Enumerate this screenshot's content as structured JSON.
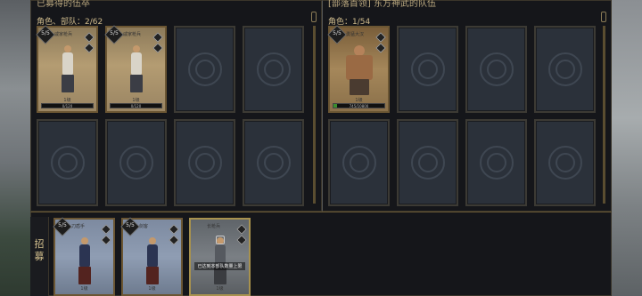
{
  "left_panel": {
    "title": "已募得的伍卒",
    "count_label": "角色、部队：2/62",
    "cards": [
      {
        "level": "5/5",
        "name": "戚家枪兵",
        "tier": "1级",
        "exp": "0/120",
        "exp_fraction": 0.0
      },
      {
        "level": "5/5",
        "name": "戚家枪兵",
        "tier": "1级",
        "exp": "0/120",
        "exp_fraction": 0.0
      }
    ]
  },
  "right_panel": {
    "title": "[部落首领] 东方神武的队伍",
    "count_label": "角色：1/54",
    "cards": [
      {
        "level": "5/5",
        "name": "勇猛大汉",
        "tier": "1级",
        "exp": "745/10800",
        "exp_fraction": 0.069
      }
    ]
  },
  "recruit": {
    "tab_label": "招募",
    "cards": [
      {
        "level": "5/5",
        "name": "刀盾手",
        "tier": "1级"
      },
      {
        "level": "5/5",
        "name": "剑客",
        "tier": "1级"
      },
      {
        "name": "长枪兵",
        "tier": "1级",
        "lock_note": "已达到本部队数量上限"
      }
    ]
  },
  "icons": {
    "empty_slot": "hexagram-emblem-icon",
    "lock": "lock-icon",
    "stat": "diamond-stat-icon"
  },
  "colors": {
    "gold_border": "#a8924e",
    "exp_green": "#3b8e2d",
    "panel_bg": "#15161a"
  }
}
